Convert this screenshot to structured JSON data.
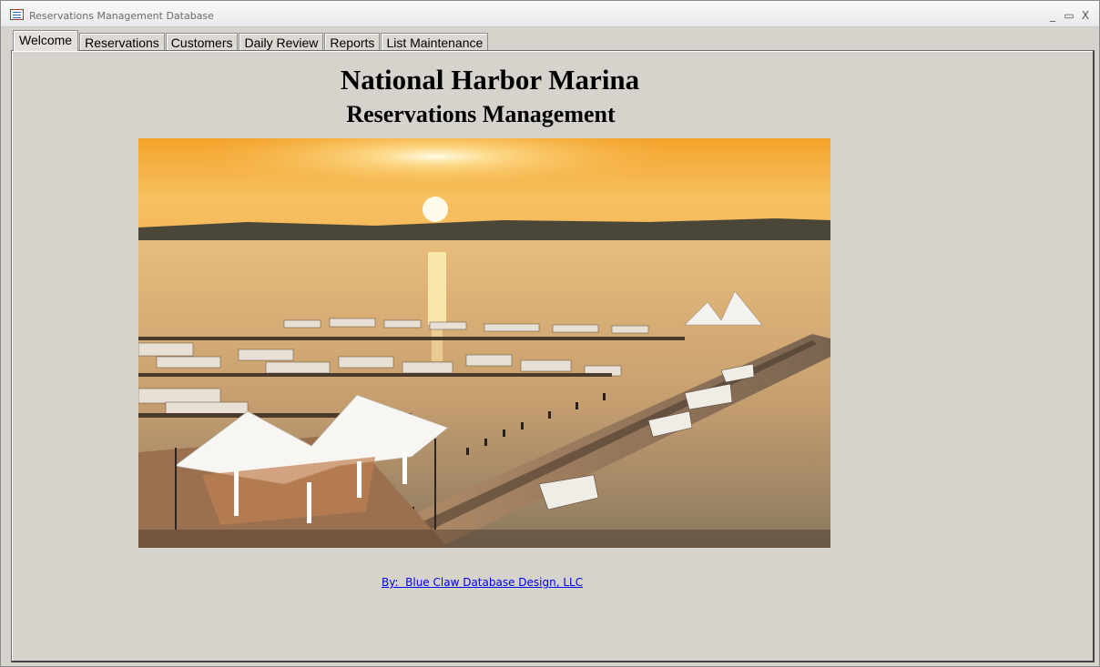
{
  "window": {
    "title": "Reservations Management Database",
    "controls": [
      "_",
      "▭",
      "X"
    ]
  },
  "tabs": [
    {
      "label": "Welcome",
      "active": true
    },
    {
      "label": "Reservations",
      "active": false
    },
    {
      "label": "Customers",
      "active": false
    },
    {
      "label": "Daily Review",
      "active": false
    },
    {
      "label": "Reports",
      "active": false
    },
    {
      "label": "List Maintenance",
      "active": false
    }
  ],
  "welcome": {
    "heading": "National Harbor Marina",
    "subheading": "Reservations Management",
    "credit_link": "By:  Blue Claw Database Design, LLC"
  },
  "colors": {
    "window_bg": "#d6d2cc",
    "link": "#0000ee",
    "sky_top": "#f0a030",
    "sun": "#fff8d0",
    "water": "#c89860"
  }
}
